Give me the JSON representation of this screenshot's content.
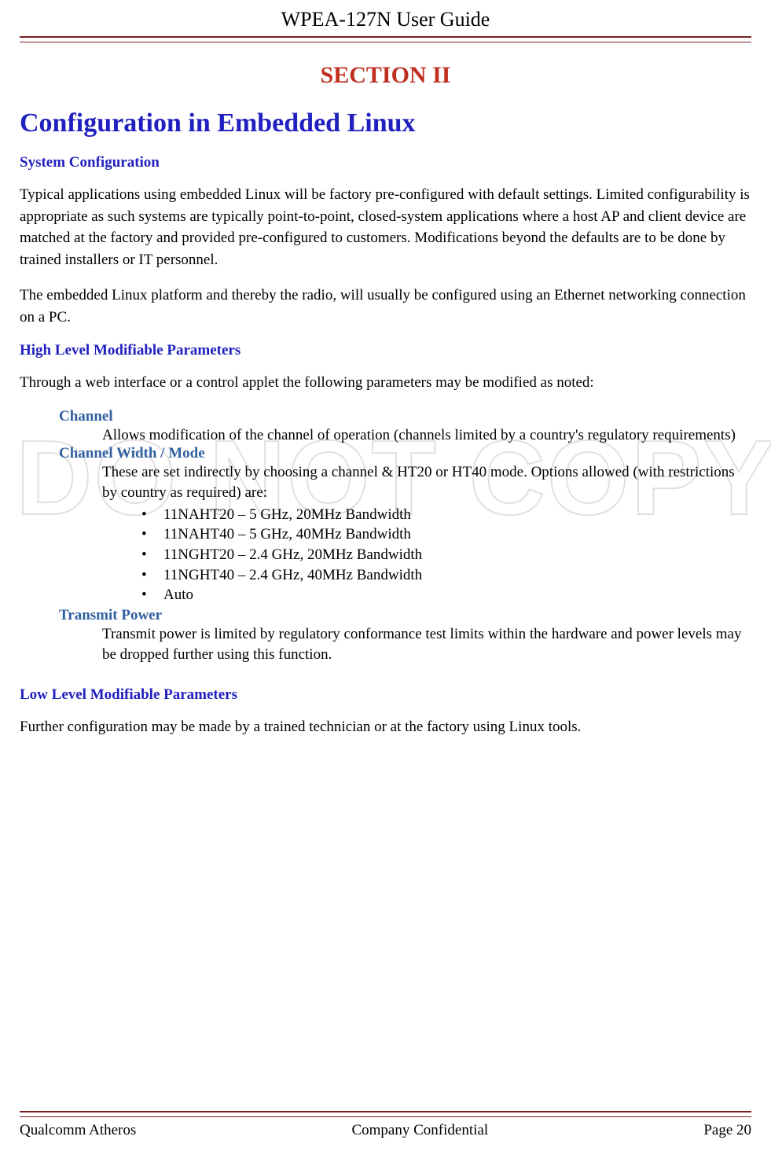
{
  "header": {
    "title": "WPEA-127N User Guide"
  },
  "watermark": "DO NOT COPY",
  "section": {
    "label": "SECTION II",
    "main_heading": "Configuration in Embedded Linux"
  },
  "system_config": {
    "heading": "System Configuration",
    "para1": "Typical applications using embedded Linux will be factory pre-configured with default settings. Limited configurability is appropriate as such systems are typically point-to-point, closed-system applications where a host AP and client device are matched at the factory and provided pre-configured to customers. Modifications beyond the defaults are to be done by trained installers or IT personnel.",
    "para2": "The embedded Linux platform and thereby the radio, will usually be configured using an Ethernet networking connection on a PC."
  },
  "high_level": {
    "heading": "High Level Modifiable Parameters",
    "intro": "Through a web interface or a control applet the following parameters may be modified as noted:",
    "params": {
      "channel": {
        "name": "Channel",
        "desc": "Allows modification of the channel of operation (channels limited by a country's regulatory requirements)"
      },
      "channel_width": {
        "name": "Channel Width / Mode",
        "desc": "These are set indirectly by choosing a channel & HT20 or HT40 mode. Options allowed (with restrictions by country as required) are:",
        "options": [
          "11NAHT20 – 5 GHz, 20MHz Bandwidth",
          "11NAHT40 – 5 GHz, 40MHz Bandwidth",
          "11NGHT20 – 2.4 GHz, 20MHz Bandwidth",
          "11NGHT40 – 2.4 GHz, 40MHz Bandwidth",
          "Auto"
        ]
      },
      "transmit_power": {
        "name": "Transmit Power",
        "desc": "Transmit power is limited by regulatory conformance test limits within the hardware and power levels may be dropped further using this function."
      }
    }
  },
  "low_level": {
    "heading": "Low Level Modifiable Parameters",
    "para": "Further configuration may be made by a trained technician or at the factory using Linux tools."
  },
  "footer": {
    "left": "Qualcomm Atheros",
    "center": "Company Confidential",
    "right": "Page 20"
  }
}
